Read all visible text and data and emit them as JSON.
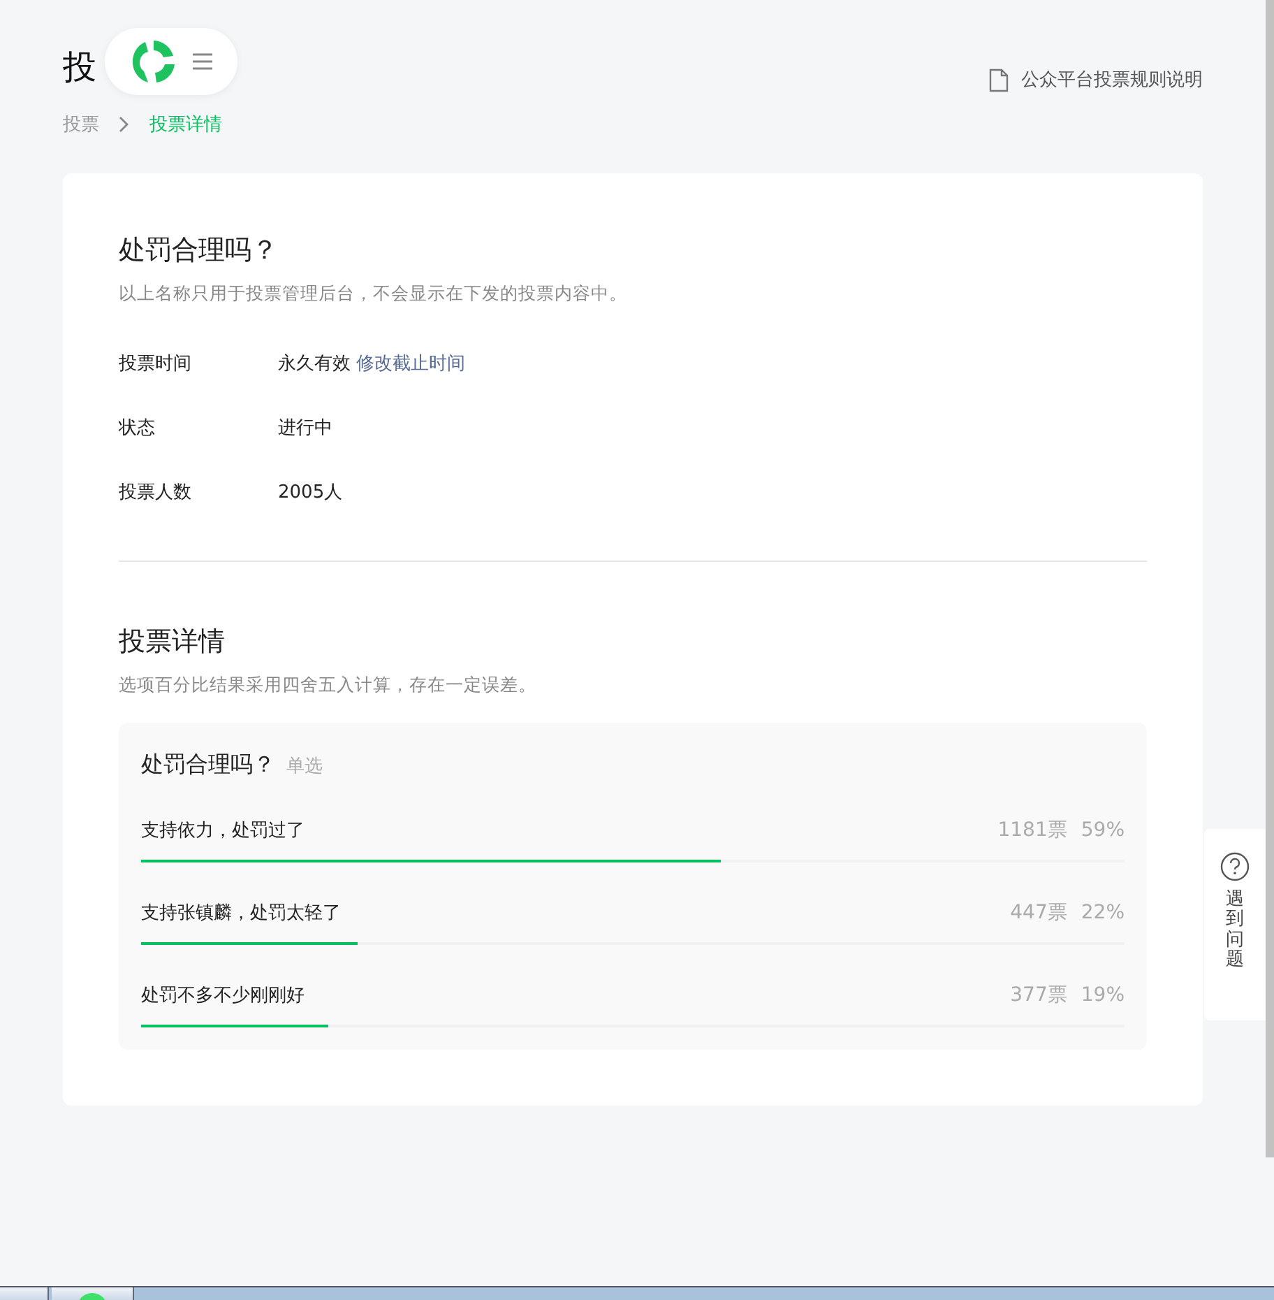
{
  "page": {
    "title": "投",
    "rules_link": "公众平台投票规则说明"
  },
  "breadcrumb": [
    {
      "label": "投票",
      "selected": false
    },
    {
      "label": "投票详情",
      "selected": true
    }
  ],
  "info": {
    "name": "处罚合理吗？",
    "note": "以上名称只用于投票管理后台，不会显示在下发的投票内容中。",
    "fields": [
      {
        "label": "投票时间",
        "value": "永久有效",
        "link": "修改截止时间"
      },
      {
        "label": "状态",
        "value": "进行中"
      },
      {
        "label": "投票人数",
        "value": "2005人"
      }
    ]
  },
  "details": {
    "heading": "投票详情",
    "note": "选项百分比结果采用四舍五入计算，存在一定误差。",
    "question": "处罚合理吗？",
    "question_type": "单选",
    "options": [
      {
        "label": "支持依力，处罚过了",
        "votes": "1181票",
        "percent": "59%",
        "level": 0.59
      },
      {
        "label": "支持张镇麟，处罚太轻了",
        "votes": "447票",
        "percent": "22%",
        "level": 0.22
      },
      {
        "label": "处罚不多不少刚刚好",
        "votes": "377票",
        "percent": "19%",
        "level": 0.19
      }
    ]
  },
  "help": {
    "label": "遇到问题"
  }
}
